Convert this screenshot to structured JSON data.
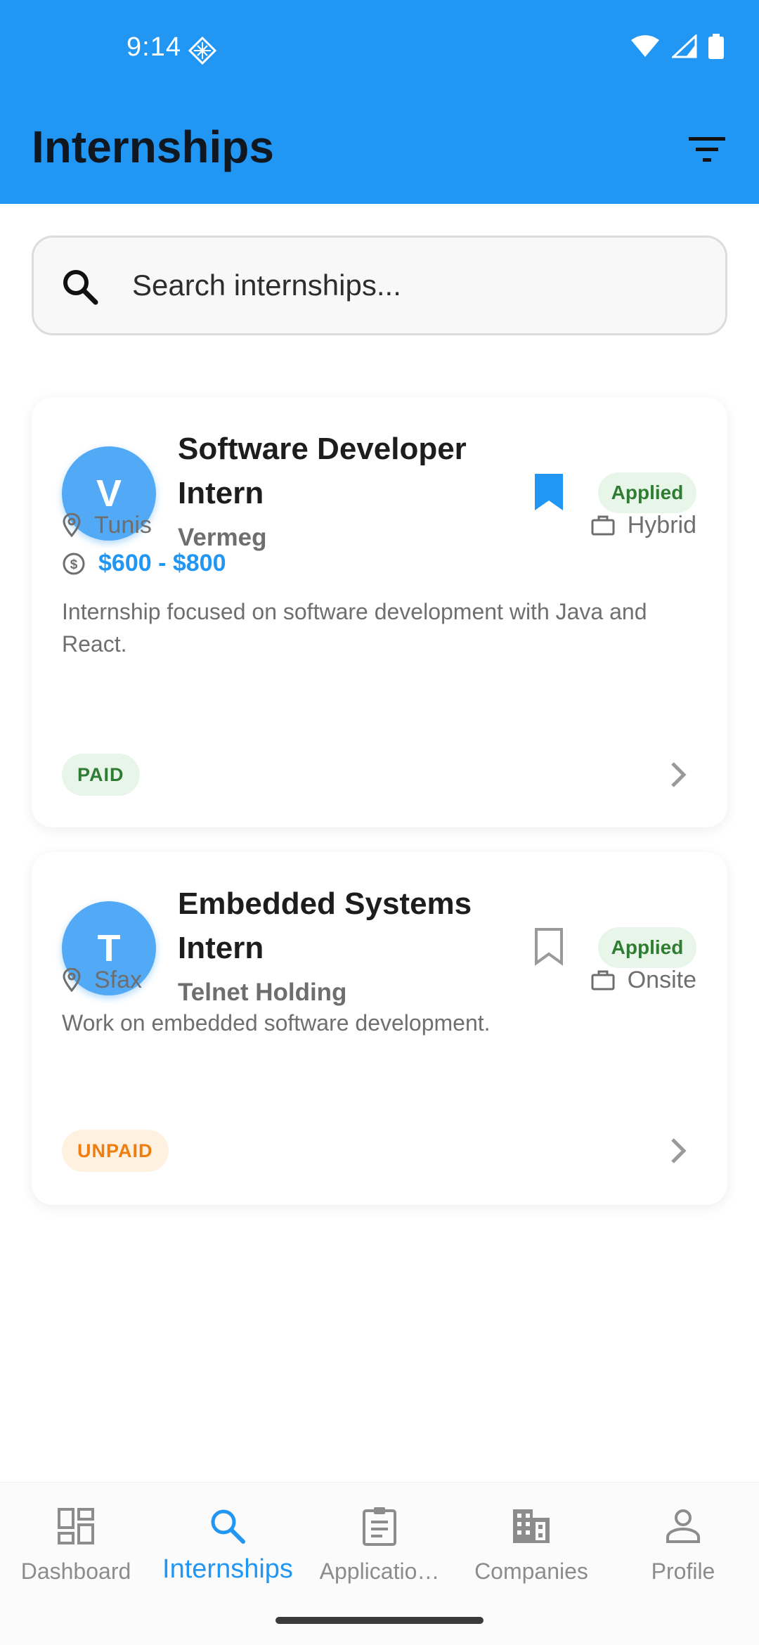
{
  "status_bar": {
    "time": "9:14"
  },
  "header": {
    "title": "Internships"
  },
  "search": {
    "placeholder": "Search internships..."
  },
  "internships": [
    {
      "avatar_letter": "V",
      "title": "Software Developer Intern",
      "company": "Vermeg",
      "bookmarked": true,
      "status": "Applied",
      "location": "Tunis",
      "work_mode": "Hybrid",
      "salary": "$600 - $800",
      "description": "Internship focused on software development with Java and React.",
      "pay_type": "PAID"
    },
    {
      "avatar_letter": "T",
      "title": "Embedded Systems Intern",
      "company": "Telnet Holding",
      "bookmarked": false,
      "status": "Applied",
      "location": "Sfax",
      "work_mode": "Onsite",
      "description": "Work on embedded software development.",
      "pay_type": "UNPAID"
    }
  ],
  "bottom_nav": {
    "items": [
      {
        "label": "Dashboard",
        "icon": "dashboard-icon"
      },
      {
        "label": "Internships",
        "icon": "search-icon"
      },
      {
        "label": "Applicatio…",
        "icon": "clipboard-icon"
      },
      {
        "label": "Companies",
        "icon": "building-icon"
      },
      {
        "label": "Profile",
        "icon": "person-icon"
      }
    ],
    "active_index": 1
  },
  "colors": {
    "primary": "#2196F3",
    "applied_bg": "#e8f5e9",
    "applied_text": "#2e7d32",
    "unpaid_bg": "#fff1e0",
    "unpaid_text": "#ef7d0f"
  }
}
